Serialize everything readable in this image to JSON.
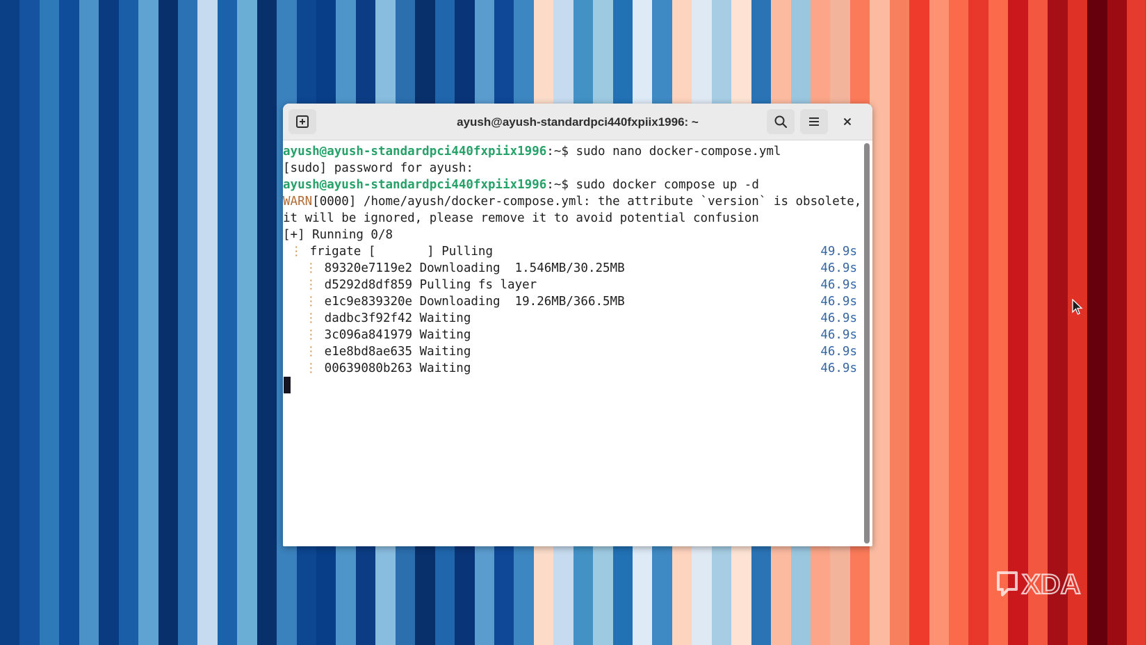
{
  "wallpaper": {
    "stripes": [
      "#0b3f86",
      "#1552a0",
      "#2e7ab8",
      "#0f4c9a",
      "#4a92c8",
      "#0a3a80",
      "#1a5ea8",
      "#5ea3d2",
      "#08306b",
      "#2a72b4",
      "#c6dbef",
      "#1b62aa",
      "#6aaed6",
      "#08306b",
      "#3a82be",
      "#0d4691",
      "#083e87",
      "#4e96c9",
      "#0c3d84",
      "#89bde0",
      "#2b6faf",
      "#08306b",
      "#1f66ad",
      "#0a3478",
      "#5b9ccf",
      "#0e4897",
      "#3c86c1",
      "#fcdbc9",
      "#c6dbef",
      "#4292c6",
      "#9dcae1",
      "#2171b5",
      "#deebf7",
      "#3e8ac4",
      "#fdd4be",
      "#dfe9f4",
      "#a6cde4",
      "#fee3d4",
      "#2a74b6",
      "#fcbba1",
      "#9ac6e0",
      "#fca588",
      "#f3b49c",
      "#fb7a5a",
      "#fcbba1",
      "#f7805f",
      "#ef3b2c",
      "#fc9272",
      "#fb6a4a",
      "#e8382c",
      "#fb6a4a",
      "#cb181d",
      "#f4573f",
      "#a50f15",
      "#e03127",
      "#67000d",
      "#9d0b12",
      "#e53a2e"
    ]
  },
  "window": {
    "title": "ayush@ayush-standardpci440fxpiix1996: ~"
  },
  "terminal": {
    "line1": {
      "prompt": "ayush@ayush-standardpci440fxpiix1996",
      "sep": ":~$ ",
      "cmd": "sudo nano docker-compose.yml"
    },
    "line2": "[sudo] password for ayush:",
    "line3": {
      "prompt": "ayush@ayush-standardpci440fxpiix1996",
      "sep": ":~$ ",
      "cmd": "sudo docker compose up -d"
    },
    "line4": {
      "warn": "WARN",
      "rest": "[0000] /home/ayush/docker-compose.yml: the attribute `version` is obsolete,"
    },
    "line5": "it will be ignored, please remove it to avoid potential confusion",
    "line6": "[+] Running 0/8",
    "frigate": {
      "dots": " ⋮ ",
      "text": "frigate [       ] Pulling",
      "time": "49.9s"
    },
    "layers": [
      {
        "dots": "   ⋮ ",
        "text": "89320e7119e2 Downloading  1.546MB/30.25MB",
        "time": "46.9s"
      },
      {
        "dots": "   ⋮ ",
        "text": "d5292d8df859 Pulling fs layer",
        "time": "46.9s"
      },
      {
        "dots": "   ⋮ ",
        "text": "e1c9e839320e Downloading  19.26MB/366.5MB",
        "time": "46.9s"
      },
      {
        "dots": "   ⋮ ",
        "text": "dadbc3f92f42 Waiting",
        "time": "46.9s"
      },
      {
        "dots": "   ⋮ ",
        "text": "3c096a841979 Waiting",
        "time": "46.9s"
      },
      {
        "dots": "   ⋮ ",
        "text": "e1e8bd8ae635 Waiting",
        "time": "46.9s"
      },
      {
        "dots": "   ⋮ ",
        "text": "00639080b263 Waiting",
        "time": "46.9s"
      }
    ]
  },
  "icons": {
    "new_tab": "new-tab-icon",
    "search": "search-icon",
    "menu": "hamburger-menu-icon",
    "close": "close-icon"
  },
  "watermark": {
    "text": "XDA"
  }
}
